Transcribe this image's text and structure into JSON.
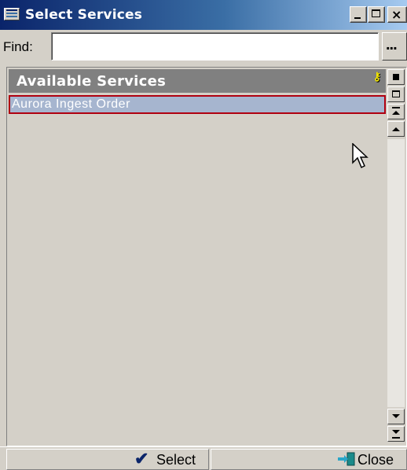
{
  "window": {
    "title": "Select Services"
  },
  "find": {
    "label": "Find:",
    "value": "",
    "placeholder": "",
    "browse_label": "..."
  },
  "list": {
    "header": "Available Services",
    "items": [
      {
        "label": "Aurora Ingest Order",
        "selected": true
      }
    ]
  },
  "footer": {
    "select_label": "Select",
    "close_label": "Close"
  },
  "icons": {
    "app": "window-icon",
    "key": "key-icon",
    "select": "checkmark-icon",
    "close": "exit-door-icon"
  },
  "colors": {
    "title_bar": "#0a246a",
    "selection_fill": "#a6b5cf",
    "selection_border": "#b00010",
    "header_bg": "#808080"
  }
}
